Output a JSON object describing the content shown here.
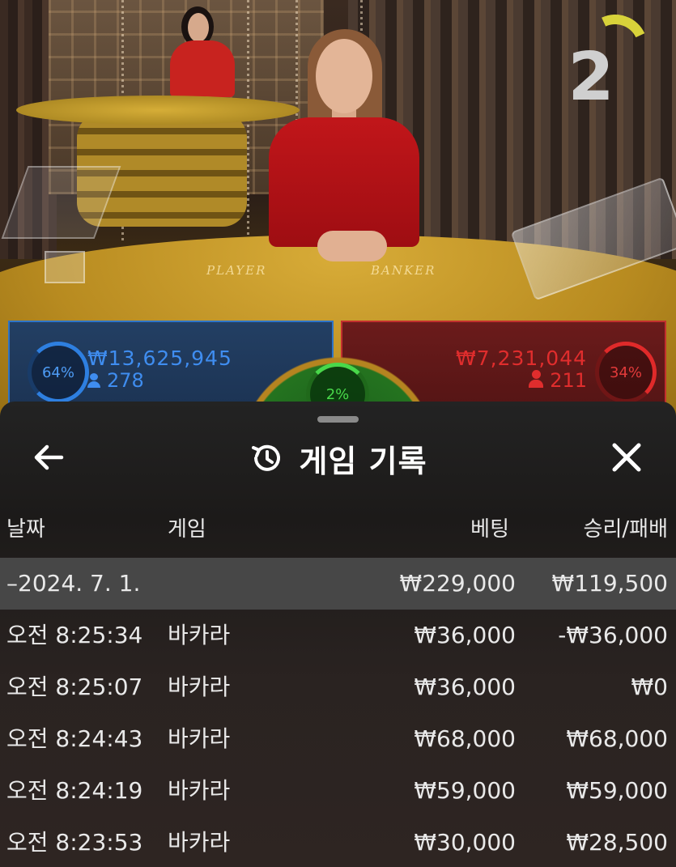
{
  "video": {
    "table_labels": {
      "player": "PLAYER",
      "banker": "BANKER"
    },
    "countdown": "2",
    "countdown_arc_color": "#d8d23a",
    "player": {
      "percent": "64%",
      "amount": "₩13,625,945",
      "count": "278",
      "color": "#3f8df0"
    },
    "banker": {
      "percent": "34%",
      "amount": "₩7,231,044",
      "count": "211",
      "color": "#e02d2d"
    },
    "tie": {
      "percent": "2%",
      "color": "#49d84a"
    }
  },
  "history": {
    "title": "게임 기록",
    "icons": {
      "back": "arrow-left-icon",
      "history": "history-clock-icon",
      "close": "close-icon"
    },
    "columns": {
      "date": "날짜",
      "game": "게임",
      "bet": "베팅",
      "win": "승리/패배"
    },
    "date_group": {
      "date": "–2024. 7. 1.",
      "bet": "₩229,000",
      "win": "₩119,500"
    },
    "rows": [
      {
        "time": "오전 8:25:34",
        "game": "바카라",
        "bet": "₩36,000",
        "win": "-₩36,000"
      },
      {
        "time": "오전 8:25:07",
        "game": "바카라",
        "bet": "₩36,000",
        "win": "₩0"
      },
      {
        "time": "오전 8:24:43",
        "game": "바카라",
        "bet": "₩68,000",
        "win": "₩68,000"
      },
      {
        "time": "오전 8:24:19",
        "game": "바카라",
        "bet": "₩59,000",
        "win": "₩59,000"
      },
      {
        "time": "오전 8:23:53",
        "game": "바카라",
        "bet": "₩30,000",
        "win": "₩28,500"
      }
    ]
  }
}
